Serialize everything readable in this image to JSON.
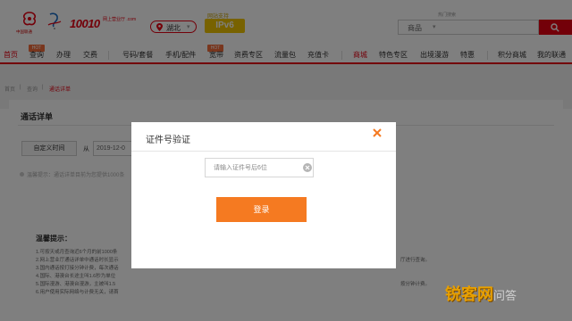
{
  "header": {
    "brand_number": "10010",
    "brand_sub": "网上营业厅 .com",
    "brand_caption": "中国联通",
    "province": "湖北",
    "ipv6_caption": "网站支持",
    "ipv6_badge": "IPv6",
    "search_scope": "商品",
    "hot_search": "热门搜索"
  },
  "nav": {
    "hot_badge": "HOT",
    "items": [
      "首页",
      "查询",
      "办理",
      "交费",
      "号码/套餐",
      "手机/配件",
      "宽带",
      "资费专区",
      "流量包",
      "充值卡",
      "商城",
      "特色专区",
      "出境漫游",
      "特惠",
      "积分商城",
      "我的联通"
    ]
  },
  "breadcrumb": {
    "items": [
      "首页",
      "查询",
      "通话详单"
    ]
  },
  "page": {
    "title": "通话详单",
    "custom_time_button": "自定义时间",
    "from_label": "从",
    "start_date": "2019-12-0",
    "notice": "温馨提示：通话详单目前为您提供1000条"
  },
  "tips": {
    "title": "温馨提示：",
    "lines": [
      "1.可按天或月查询近6个月的前1000条",
      "2.网上营业厅通话详单中通话时长显示",
      "3.国内通话按打接分钟计费，每次通话",
      "4.国际、港澳台长途主叫1.6秒为单位",
      "5.国际漫游、港澳台漫游，主被叫1.5",
      "6.用户使用实际网络与计费无关，请首"
    ],
    "right_fragments": [
      "厅进行查询。",
      "按分钟计费。"
    ]
  },
  "modal": {
    "title": "证件号验证",
    "input_placeholder": "请输入证件号后6位",
    "submit_label": "登录"
  },
  "watermark": {
    "primary": "锐客网",
    "secondary": "问答"
  },
  "colors": {
    "brand_red": "#e60012",
    "button_orange": "#f57a21",
    "close_orange": "#f57a21",
    "ipv6_yellow": "#f0c400"
  }
}
